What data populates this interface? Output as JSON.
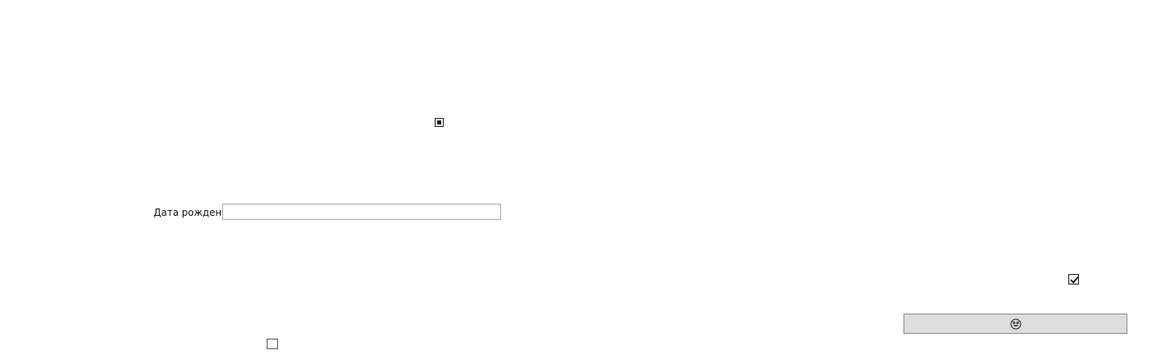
{
  "form": {
    "option_top_checkbox": {
      "state": "indeterminate"
    },
    "birth_date": {
      "label": "Дата рождения",
      "value": "",
      "placeholder": ""
    },
    "option_right_checkbox": {
      "state": "checked"
    },
    "emoji_button": {
      "icon": "smiley-face-icon"
    },
    "option_bottom_checkbox": {
      "state": "unchecked"
    }
  }
}
